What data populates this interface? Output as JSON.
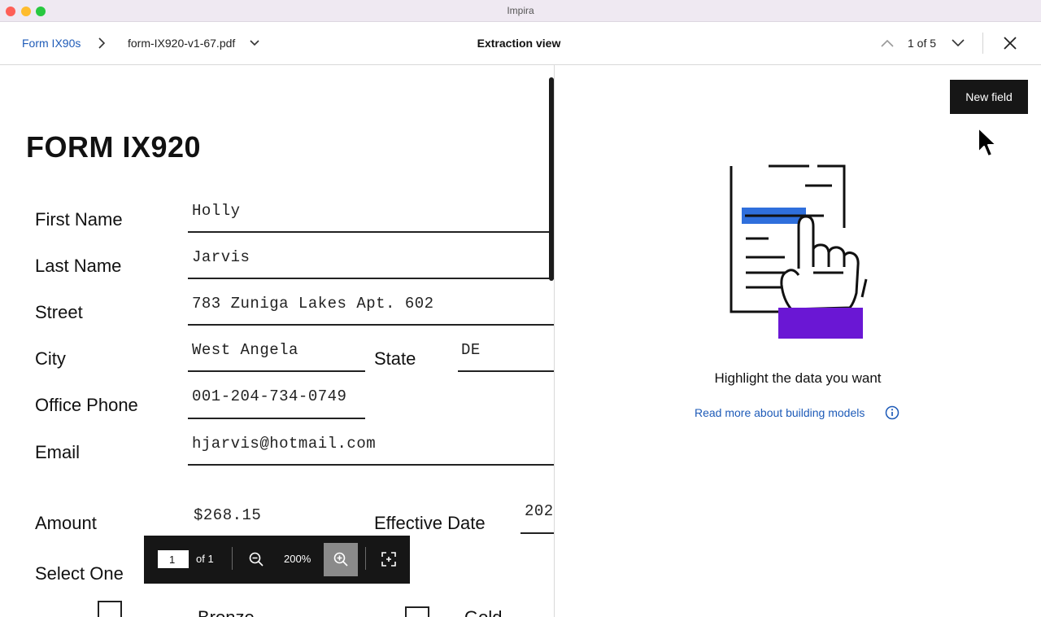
{
  "window": {
    "title": "Impira"
  },
  "header": {
    "breadcrumb_root": "Form IX90s",
    "file_name": "form-IX920-v1-67.pdf",
    "view_title": "Extraction view",
    "counter": "1 of 5"
  },
  "document": {
    "title": "FORM IX920",
    "fields": {
      "first_name": {
        "label": "First Name",
        "value": "Holly"
      },
      "last_name": {
        "label": "Last Name",
        "value": "Jarvis"
      },
      "street": {
        "label": "Street",
        "value": "783 Zuniga Lakes Apt. 602"
      },
      "city": {
        "label": "City",
        "value": "West Angela"
      },
      "state": {
        "label": "State",
        "value": "DE"
      },
      "office_phone": {
        "label": "Office Phone",
        "value": "001-204-734-0749"
      },
      "email": {
        "label": "Email",
        "value": "hjarvis@hotmail.com"
      },
      "amount": {
        "label": "Amount",
        "value": "$268.15"
      },
      "effective_date": {
        "label": "Effective Date",
        "value": "202"
      },
      "select_one": {
        "label": "Select One"
      }
    },
    "options": {
      "first": "Bronze",
      "second": "Gold"
    }
  },
  "viewer": {
    "page": "1",
    "page_of": "of 1",
    "zoom": "200%"
  },
  "panel": {
    "new_field_label": "New field",
    "hint": "Highlight the data you want",
    "read_more": "Read more about building models"
  },
  "colors": {
    "accent_link": "#1e5bb8",
    "highlight_blue": "#2f6fdc",
    "highlight_purple": "#6a17d4"
  }
}
